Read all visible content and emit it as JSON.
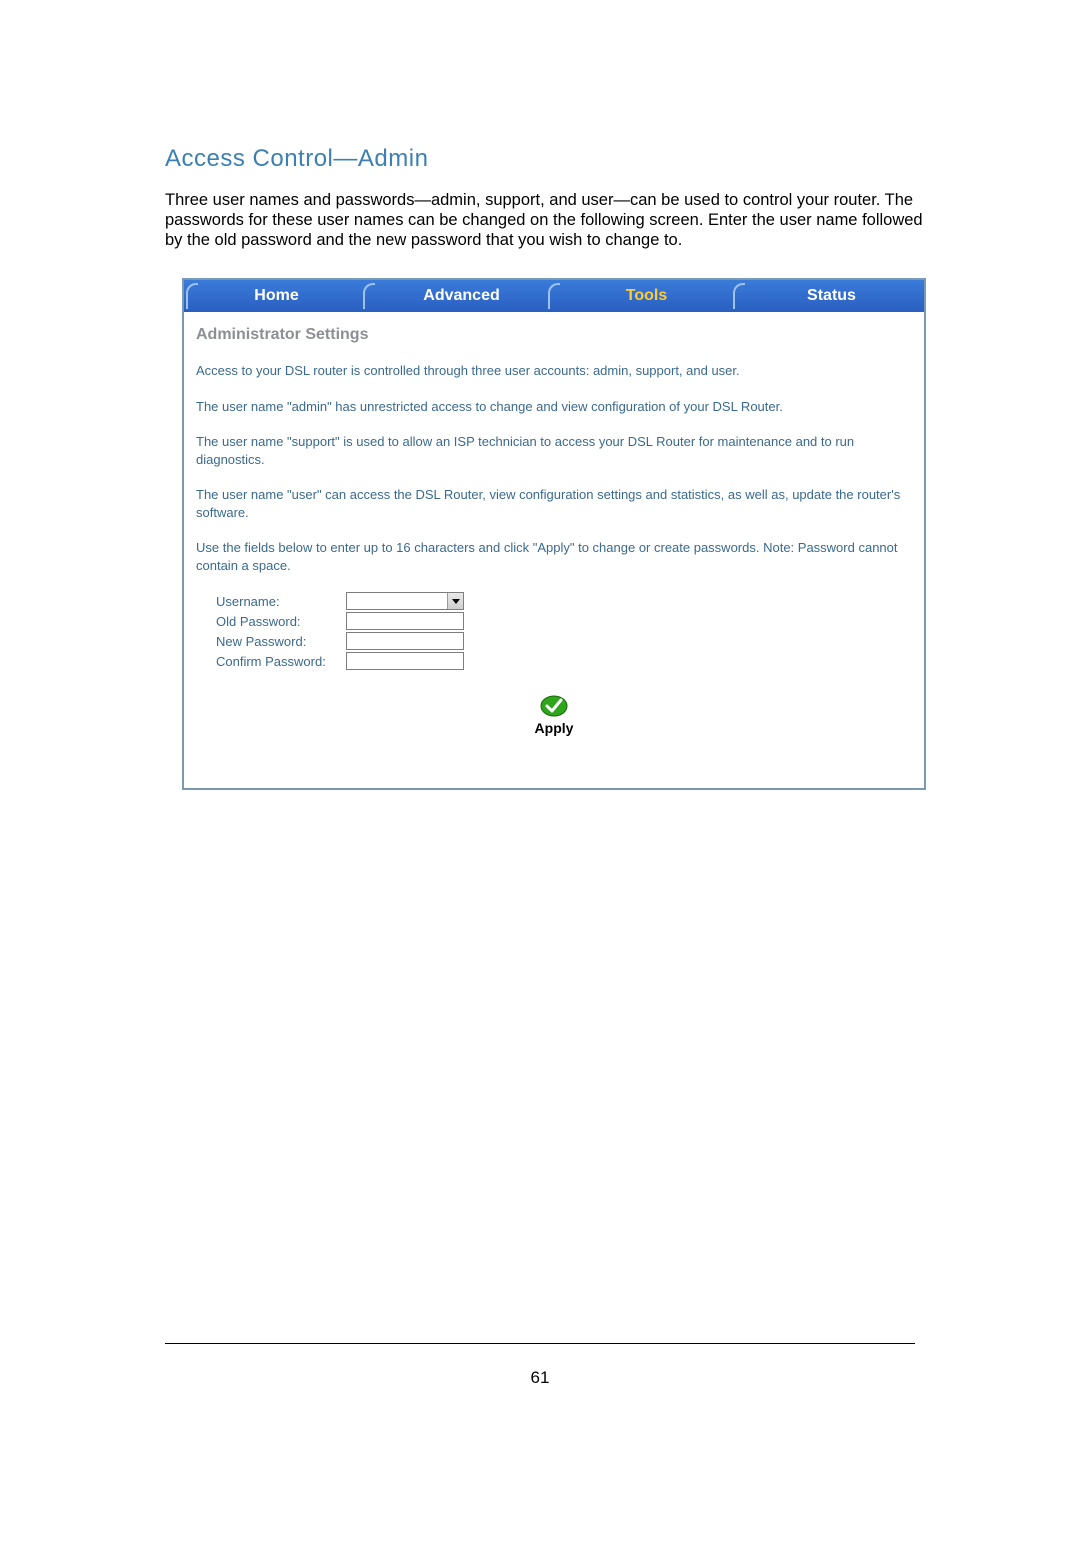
{
  "heading": "Access Control—Admin",
  "intro": "Three user names and passwords—admin, support, and user—can be used to control your router.  The passwords for these user names can be changed on the following screen.  Enter the user name followed by the old password and the new password that you wish to change to.",
  "tabs": {
    "home": "Home",
    "advanced": "Advanced",
    "tools": "Tools",
    "status": "Status"
  },
  "panel": {
    "title": "Administrator Settings",
    "p1": "Access to your DSL router is controlled through three user accounts: admin, support, and user.",
    "p2": "The user name \"admin\" has unrestricted access to change and view configuration of your DSL Router.",
    "p3": "The user name \"support\" is used to allow an ISP technician to access your DSL Router for maintenance and to run diagnostics.",
    "p4": "The user name \"user\" can access the DSL Router, view configuration settings and statistics, as well as, update the router's software.",
    "p5": "Use the fields below to enter up to 16 characters and click \"Apply\" to change or create passwords. Note: Password cannot contain a space."
  },
  "form": {
    "username_label": "Username:",
    "old_password_label": "Old Password:",
    "new_password_label": "New Password:",
    "confirm_password_label": "Confirm Password:",
    "username_value": "",
    "old_password_value": "",
    "new_password_value": "",
    "confirm_password_value": ""
  },
  "apply_label": "Apply",
  "page_number": "61"
}
